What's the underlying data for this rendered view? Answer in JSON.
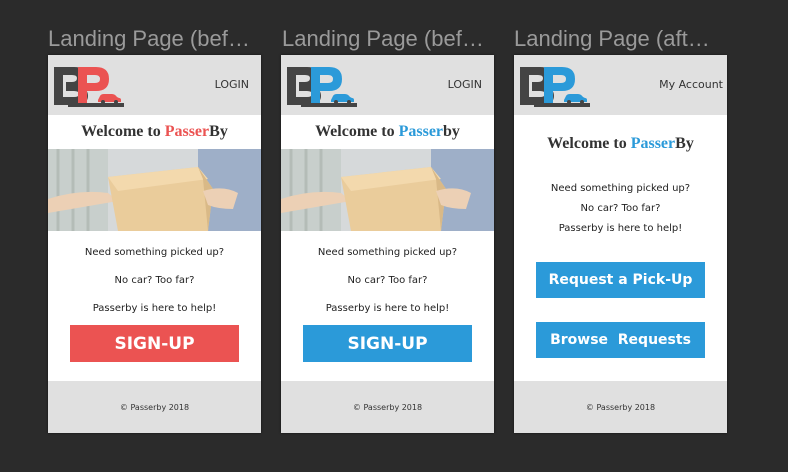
{
  "frames": [
    {
      "title": "Landing Page (bef…",
      "header_link": "LOGIN",
      "welcome": "Welcome to ",
      "brand_a": "Passer",
      "brand_b": "By",
      "lines": [
        "Need something picked up?",
        "No car? Too far?",
        "Passerby is here to help!"
      ],
      "button": "SIGN-UP",
      "footer": "© Passerby 2018"
    },
    {
      "title": "Landing Page (bef…",
      "header_link": "LOGIN",
      "welcome": "Welcome to ",
      "brand_a": "Passer",
      "brand_b": "by",
      "lines": [
        "Need something picked up?",
        "No car? Too far?",
        "Passerby is here to help!"
      ],
      "button": "SIGN-UP",
      "footer": "© Passerby 2018"
    },
    {
      "title": "Landing Page (aft…",
      "header_link": "My Account",
      "welcome": "Welcome to ",
      "brand_a": "Passer",
      "brand_b": "By",
      "lines": [
        "Need something picked up?",
        "No car? Too far?",
        "Passerby is here to help!"
      ],
      "button_primary": "Request a Pick-Up",
      "button_secondary": "Browse  Requests",
      "footer": "© Passerby 2018"
    }
  ],
  "colors": {
    "red": "#eb5352",
    "blue": "#2b9ad9",
    "dark": "#444444"
  }
}
